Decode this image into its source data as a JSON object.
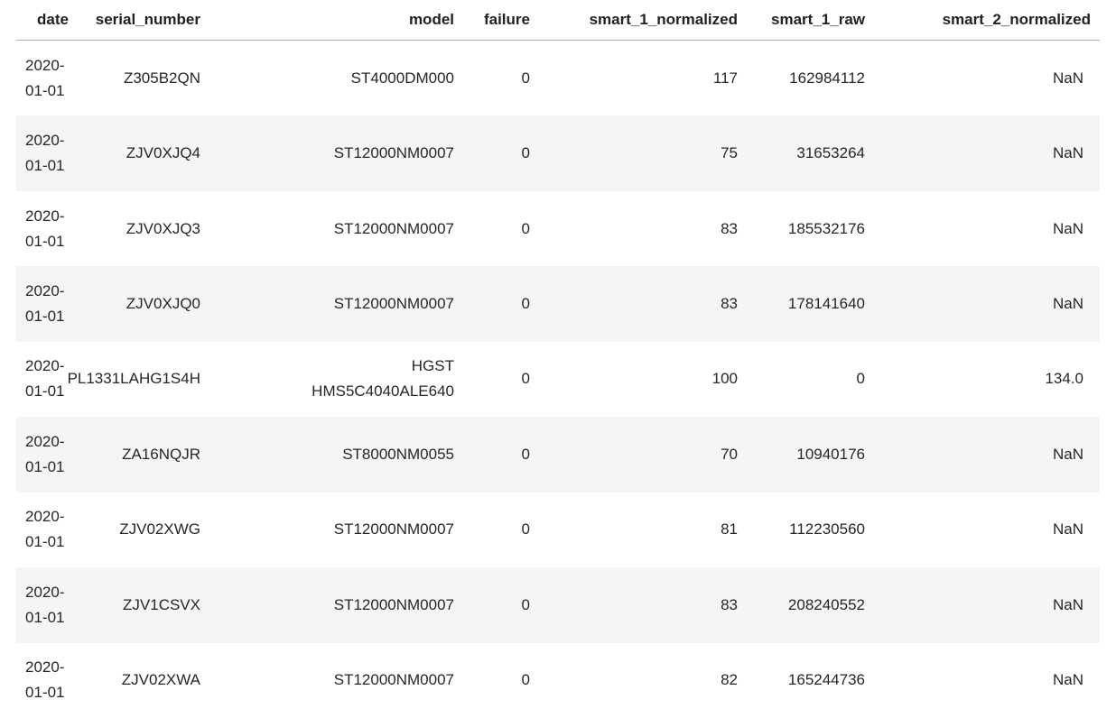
{
  "table": {
    "columns": [
      {
        "key": "date",
        "label": "date"
      },
      {
        "key": "serial_number",
        "label": "serial_number"
      },
      {
        "key": "model",
        "label": "model"
      },
      {
        "key": "failure",
        "label": "failure"
      },
      {
        "key": "smart_1_normalized",
        "label": "smart_1_normalized"
      },
      {
        "key": "smart_1_raw",
        "label": "smart_1_raw"
      },
      {
        "key": "smart_2_normalized",
        "label": "smart_2_normalized"
      }
    ],
    "rows": [
      [
        "2020-01-01",
        "Z305B2QN",
        "ST4000DM000",
        "0",
        "117",
        "162984112",
        "NaN"
      ],
      [
        "2020-01-01",
        "ZJV0XJQ4",
        "ST12000NM0007",
        "0",
        "75",
        "31653264",
        "NaN"
      ],
      [
        "2020-01-01",
        "ZJV0XJQ3",
        "ST12000NM0007",
        "0",
        "83",
        "185532176",
        "NaN"
      ],
      [
        "2020-01-01",
        "ZJV0XJQ0",
        "ST12000NM0007",
        "0",
        "83",
        "178141640",
        "NaN"
      ],
      [
        "2020-01-01",
        "PL1331LAHG1S4H",
        "HGST HMS5C4040ALE640",
        "0",
        "100",
        "0",
        "134.0"
      ],
      [
        "2020-01-01",
        "ZA16NQJR",
        "ST8000NM0055",
        "0",
        "70",
        "10940176",
        "NaN"
      ],
      [
        "2020-01-01",
        "ZJV02XWG",
        "ST12000NM0007",
        "0",
        "81",
        "112230560",
        "NaN"
      ],
      [
        "2020-01-01",
        "ZJV1CSVX",
        "ST12000NM0007",
        "0",
        "83",
        "208240552",
        "NaN"
      ],
      [
        "2020-01-01",
        "ZJV02XWA",
        "ST12000NM0007",
        "0",
        "82",
        "165244736",
        "NaN"
      ]
    ],
    "colors": {
      "background": "#ffffff",
      "stripe": "#f5f5f5",
      "header_border": "#a9a9a9",
      "header_text": "#212121",
      "text": "#262626"
    }
  }
}
